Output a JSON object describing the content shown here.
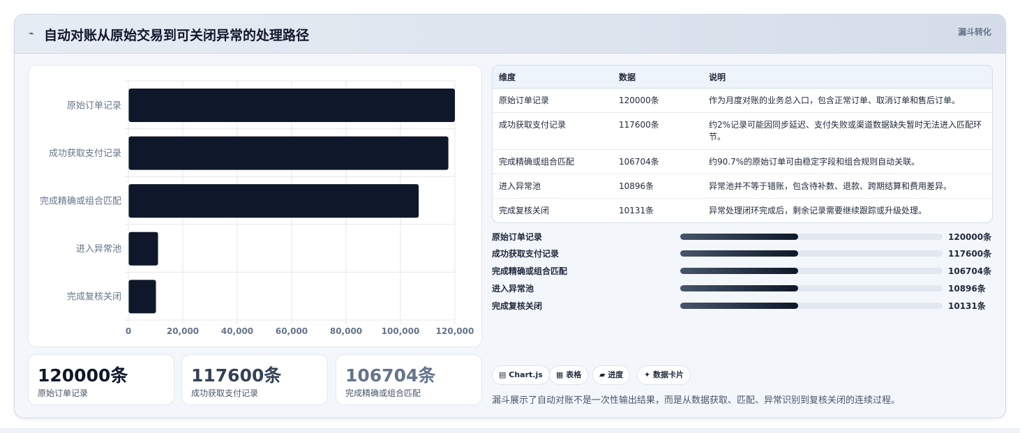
{
  "header": {
    "icon": "⌁",
    "title": "自动对账从原始交易到可关闭异常的处理路径",
    "tag": "漏斗转化"
  },
  "colors": {
    "bar": "#0f172a",
    "accent": "#0f172a",
    "muted_text": "#64748b"
  },
  "chart_data": {
    "type": "bar",
    "orientation": "horizontal",
    "categories": [
      "原始订单记录",
      "成功获取支付记录",
      "完成精确或组合匹配",
      "进入异常池",
      "完成复核关闭"
    ],
    "values": [
      120000,
      117600,
      106704,
      10896,
      10131
    ],
    "xlim": [
      0,
      120000
    ],
    "xticks": [
      0,
      20000,
      40000,
      60000,
      80000,
      100000,
      120000
    ],
    "xtick_labels": [
      "0",
      "20,000",
      "40,000",
      "60,000",
      "80,000",
      "100,000",
      "120,000"
    ],
    "grid": true,
    "legend": "none"
  },
  "kpis": [
    {
      "value": "120000条",
      "label": "原始订单记录",
      "color": "#0f172a"
    },
    {
      "value": "117600条",
      "label": "成功获取支付记录",
      "color": "#334155"
    },
    {
      "value": "106704条",
      "label": "完成精确或组合匹配",
      "color": "#64748b"
    }
  ],
  "table": {
    "headers": [
      "维度",
      "数据",
      "说明"
    ],
    "rows": [
      [
        "原始订单记录",
        "120000条",
        "作为月度对账的业务总入口，包含正常订单、取消订单和售后订单。"
      ],
      [
        "成功获取支付记录",
        "117600条",
        "约2%记录可能因同步延迟、支付失败或渠道数据缺失暂时无法进入匹配环节。"
      ],
      [
        "完成精确或组合匹配",
        "106704条",
        "约90.7%的原始订单可由稳定字段和组合规则自动关联。"
      ],
      [
        "进入异常池",
        "10896条",
        "异常池并不等于错账，包含待补数、退款、跨期结算和费用差异。"
      ],
      [
        "完成复核关闭",
        "10131条",
        "异常处理闭环完成后，剩余记录需要继续跟踪或升级处理。"
      ]
    ]
  },
  "progress": [
    {
      "label": "原始订单记录",
      "value": "120000条",
      "fill": 0.45
    },
    {
      "label": "成功获取支付记录",
      "value": "117600条",
      "fill": 0.45
    },
    {
      "label": "完成精确或组合匹配",
      "value": "106704条",
      "fill": 0.45
    },
    {
      "label": "进入异常池",
      "value": "10896条",
      "fill": 0.45
    },
    {
      "label": "完成复核关闭",
      "value": "10131条",
      "fill": 0.45
    }
  ],
  "chips": [
    {
      "icon": "▤",
      "label": "Chart.js"
    },
    {
      "icon": "▦",
      "label": "表格"
    },
    {
      "icon": "▰",
      "label": "进度"
    },
    {
      "icon": "✦",
      "label": "数据卡片"
    }
  ],
  "footnote": "漏斗展示了自动对账不是一次性输出结果，而是从数据获取、匹配、异常识别到复核关闭的连续过程。"
}
